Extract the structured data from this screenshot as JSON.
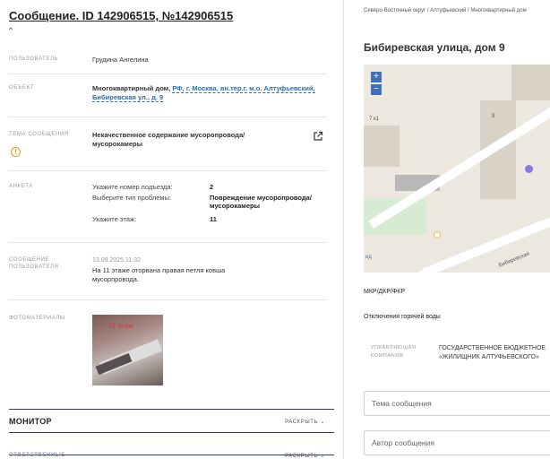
{
  "left": {
    "title": "Сообщение. ID 142906515, №142906515",
    "collapse_icon": "chevron-up-icon",
    "fields": {
      "author_label": "ПОЛЬЗОВАТЕЛЬ",
      "author_value": "Грудина Ангелина",
      "object_label": "ОБЪЕКТ",
      "object_value_type": "Многоквартирный дом,",
      "object_value_link": "РФ, г. Москва, вн.тер.г. м.о. Алтуфьевский, Бибиревская ул., д. 9",
      "topic_label": "ТЕМА СООБЩЕНИЯ",
      "topic_value": "Некачественное содержание мусоропровода/ мусорокамеры",
      "anketa_label": "АНКЕТА",
      "anketa": [
        {
          "key": "Укажите номер подъезда:",
          "value": "2"
        },
        {
          "key": "Выберите тип проблемы:",
          "value": "Повреждение мусоропровода/ мусорокамеры"
        },
        {
          "key": "Укажите этаж:",
          "value": "11"
        }
      ],
      "message_label": "СООБЩЕНИЕ ПОЛЬЗОВАТЕЛЯ",
      "message_time": "13.09.2025 11:32",
      "message_text": "На 11 этаже оторвана правая петля ковша мусорпровода.",
      "photos_label": "ФОТОМАТЕРИАЛЫ"
    },
    "monitor": {
      "title": "МОНИТОР",
      "expand": "РАСКРЫТЬ ⌄"
    },
    "responsible": {
      "title": "ОТВЕТСТВЕННЫЕ",
      "expand": "РАСКРЫТЬ ⌄"
    }
  },
  "right": {
    "breadcrumb": "Северо-Восточный округ / Алтуфьевский / Многоквартирный дом",
    "address_title": "Бибиревская улица, дом 9",
    "map": {
      "zoom_in": "+",
      "zoom_out": "−",
      "label_7k1": "7 к1",
      "label_9": "9",
      "street": "Бибиревская",
      "left_edge": "ед"
    },
    "mkr_label": "МКР/ДКР/ФКР",
    "hot_water_label": "Отключения горячей воды",
    "uk_label": "УПРАВЛЯЮЩАЯ КОМПАНИЯ",
    "uk_value_line1": "ГОСУДАРСТВЕННОЕ БЮДЖЕТНОЕ",
    "uk_value_line2": "«ЖИЛИЩНИК АЛТУФЬЕВСКОГО»",
    "topic_placeholder": "Тема сообщения",
    "author_placeholder": "Автор сообщения"
  },
  "colors": {
    "link": "#2a6db5",
    "warning": "#e29b1a",
    "section_border": "#2c3e6b",
    "map_zoom": "#3f71b8"
  }
}
